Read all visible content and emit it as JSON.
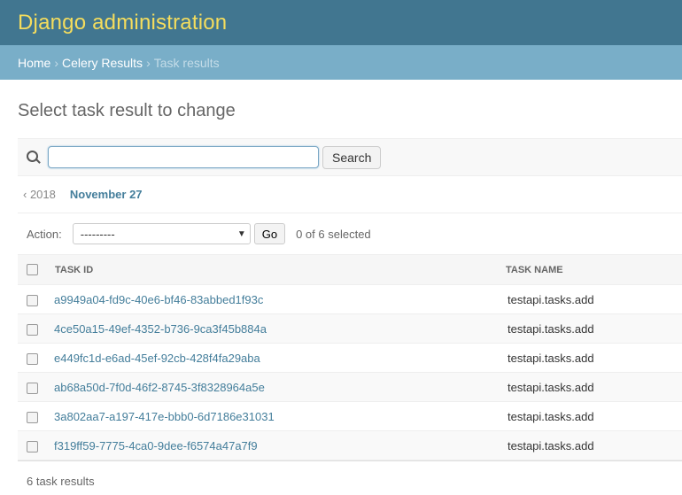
{
  "header": {
    "site_name": "Django administration"
  },
  "breadcrumbs": {
    "home": "Home",
    "app": "Celery Results",
    "current": "Task results",
    "separator": "›"
  },
  "page_title": "Select task result to change",
  "search": {
    "value": "",
    "button_label": "Search"
  },
  "date_hierarchy": {
    "back_label": "‹ 2018",
    "current_label": "November 27"
  },
  "actions": {
    "label": "Action:",
    "selected_option": "---------",
    "go_label": "Go",
    "selected_count": "0 of 6 selected"
  },
  "table": {
    "columns": [
      "Task ID",
      "Task name"
    ],
    "rows": [
      {
        "task_id": "a9949a04-fd9c-40e6-bf46-83abbed1f93c",
        "task_name": "testapi.tasks.add"
      },
      {
        "task_id": "4ce50a15-49ef-4352-b736-9ca3f45b884a",
        "task_name": "testapi.tasks.add"
      },
      {
        "task_id": "e449fc1d-e6ad-45ef-92cb-428f4fa29aba",
        "task_name": "testapi.tasks.add"
      },
      {
        "task_id": "ab68a50d-7f0d-46f2-8745-3f8328964a5e",
        "task_name": "testapi.tasks.add"
      },
      {
        "task_id": "3a802aa7-a197-417e-bbb0-6d7186e31031",
        "task_name": "testapi.tasks.add"
      },
      {
        "task_id": "f319ff59-7775-4ca0-9dee-f6574a47a7f9",
        "task_name": "testapi.tasks.add"
      }
    ]
  },
  "paginator": {
    "text": "6 task results"
  },
  "colors": {
    "header_bg": "#417690",
    "breadcrumb_bg": "#79aec8",
    "site_name": "#f5dd5d",
    "link": "#447e9b"
  },
  "icons": {
    "search": "search-icon",
    "select_arrow": "chevron-down-icon"
  }
}
